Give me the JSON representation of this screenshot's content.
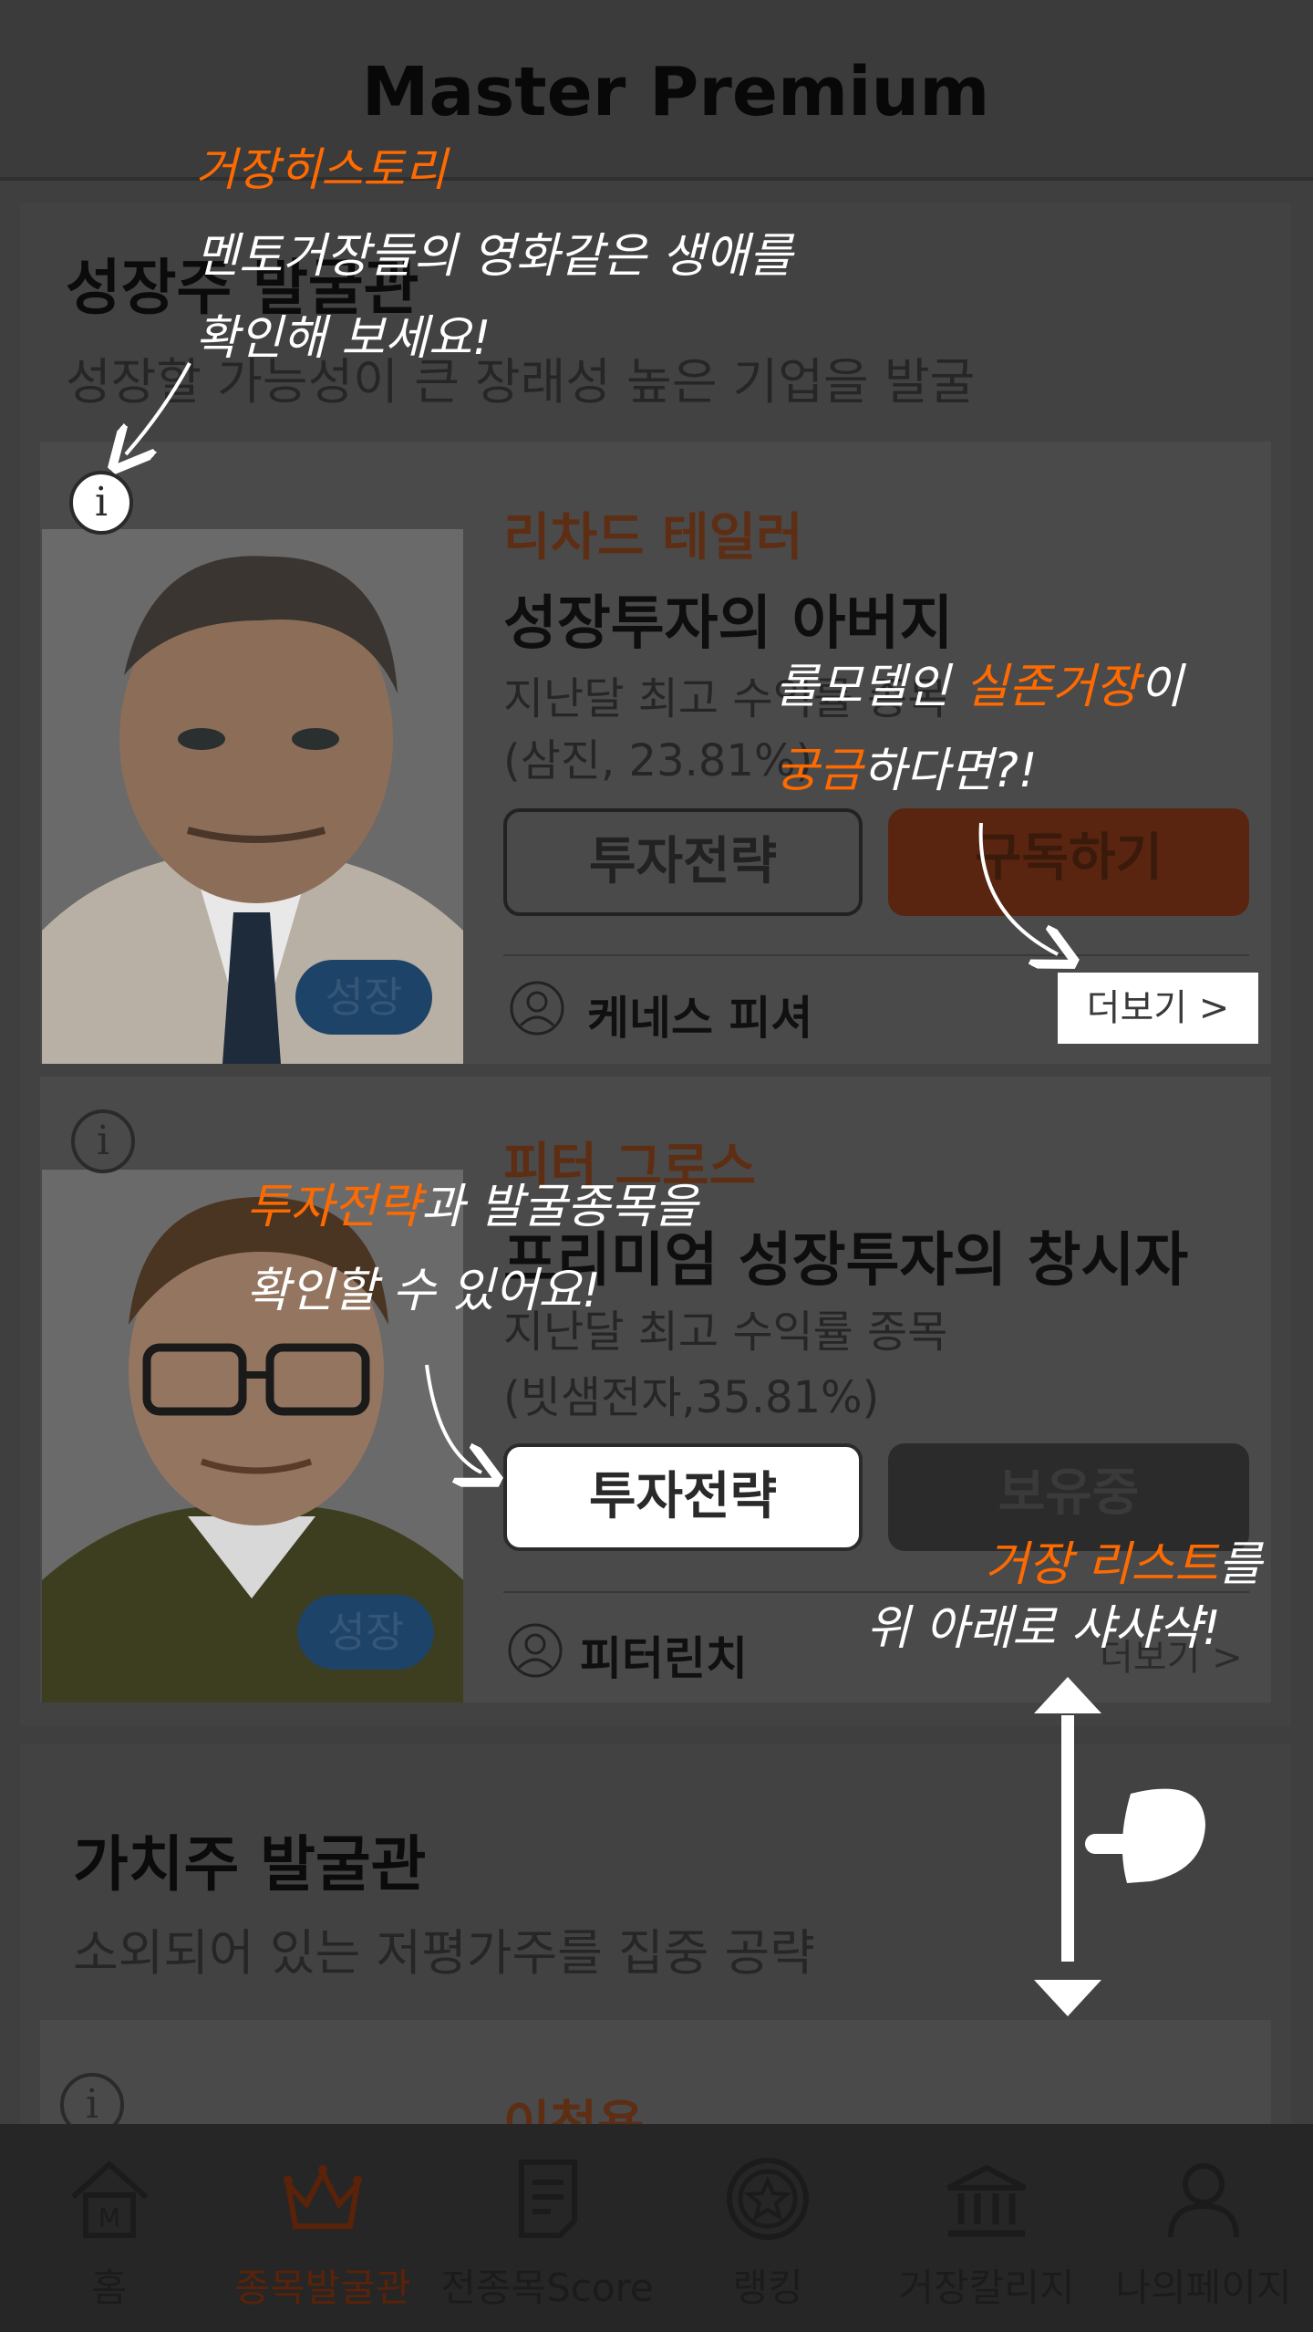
{
  "header": {
    "title": "Master Premium"
  },
  "growth": {
    "title": "성장주 발굴관",
    "subtitle": "성장할 가능성이 큰 장래성 높은 기업을 발굴",
    "cards": [
      {
        "master": "리차드 테일러",
        "headline": "성장투자의 아버지",
        "desc_line1": "지난달 최고 수익률 종목",
        "desc_line2": "(삼진, 23.81%)",
        "btn_strategy": "투자전략",
        "btn_action": "구독하기",
        "manager": "케네스 피셔",
        "more": "더보기  >",
        "tag": "성장"
      },
      {
        "master": "피터 그로스",
        "headline": "프리미엄 성장투자의 창시자",
        "desc_line1": "지난달 최고 수익률 종목",
        "desc_line2": "(빗샘전자,35.81%)",
        "btn_strategy": "투자전략",
        "btn_action": "보유중",
        "manager": "피터린치",
        "more": "더보기  >",
        "tag": "성장"
      }
    ]
  },
  "value": {
    "title": "가치주 발굴관",
    "subtitle": "소외되어 있는 저평가주를 집중 공략",
    "peek_master": "이청용"
  },
  "nav": [
    {
      "label": "홈",
      "icon": "home-icon"
    },
    {
      "label": "종목발굴관",
      "icon": "crown-icon",
      "active": true
    },
    {
      "label": "전종목Score",
      "icon": "score-icon"
    },
    {
      "label": "랭킹",
      "icon": "ranking-medal-icon"
    },
    {
      "label": "거장칼리지",
      "icon": "college-icon"
    },
    {
      "label": "나의페이지",
      "icon": "person-icon"
    }
  ],
  "tutorial": {
    "history_title": "거장히스토리",
    "history_line1": "멘토거장들의 영화같은 생애를",
    "history_line2": "확인해 보세요!",
    "role_pre": "롤모델인 ",
    "role_hl": "실존거장",
    "role_post": "이",
    "curious_hl": "궁금",
    "curious_post": "하다면?!",
    "strategy_hl": "투자전략",
    "strategy_post": "과 발굴종목을",
    "strategy_line2": "확인할 수 있어요!",
    "list_hl": "거장 리스트",
    "list_post": "를",
    "list_line2": "위 아래로 샤샤샥!"
  },
  "colors": {
    "accent": "#ff6a00",
    "brand_orange": "#c0501c",
    "tag_blue": "#1d4468"
  }
}
